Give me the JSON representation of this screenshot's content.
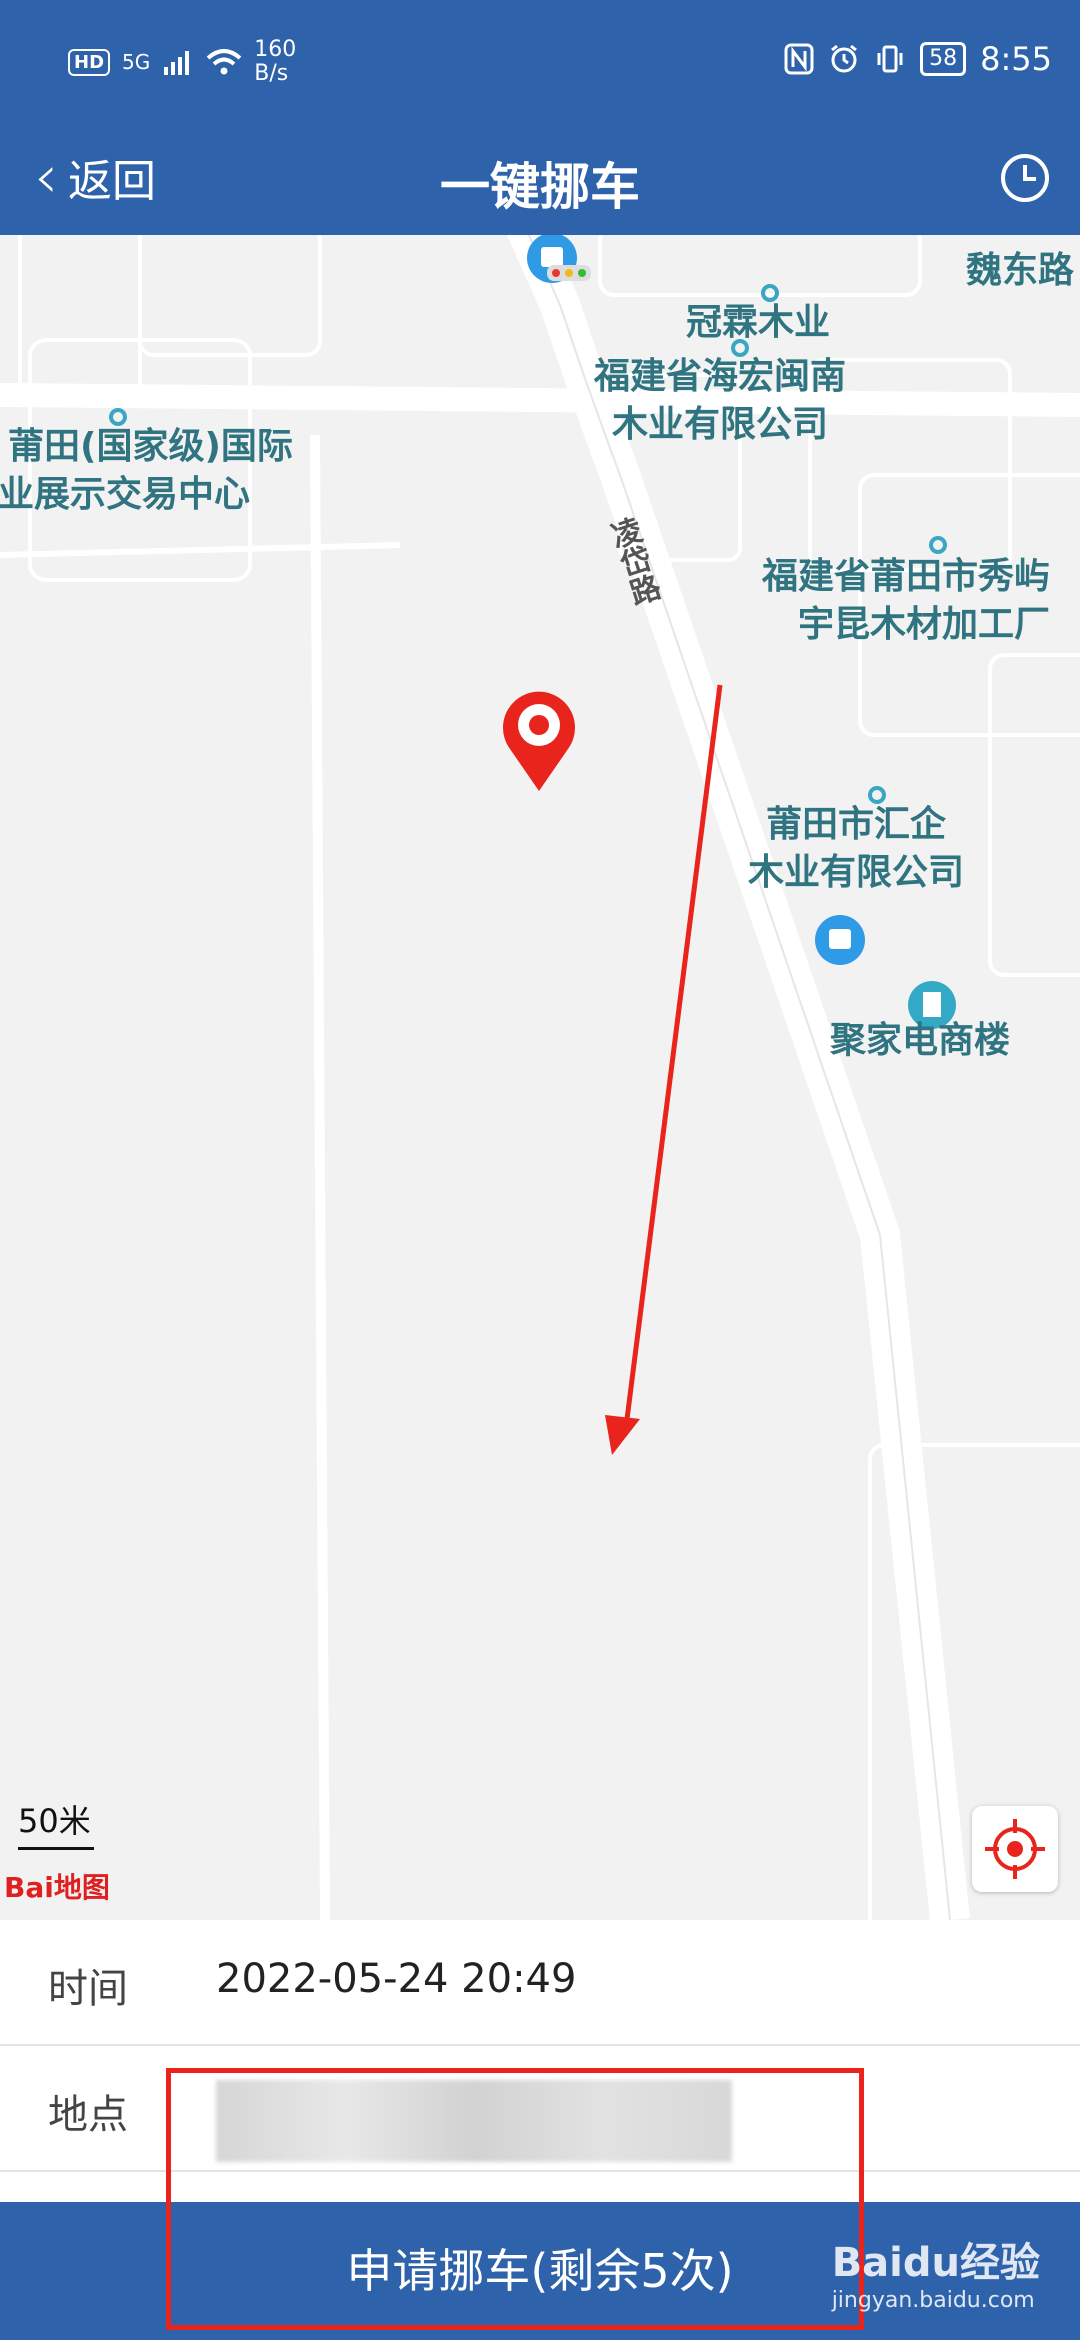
{
  "status_bar": {
    "hd": "HD",
    "network": "5G",
    "speed_value": "160",
    "speed_unit": "B/s",
    "battery": "58",
    "time": "8:55"
  },
  "header": {
    "back_label": "返回",
    "title": "一键挪车"
  },
  "map": {
    "labels": {
      "guanlin": "冠霖木业",
      "weidong": "魏东路",
      "haihong_1": "福建省海宏闽南",
      "haihong_2": "木业有限公司",
      "putian_expo_1": "莆田(国家级)国际",
      "putian_expo_2": "业展示交易中心",
      "lingdai_road": "凌岱路",
      "yukun_1": "福建省莆田市秀屿",
      "yukun_2": "宇昆木材加工厂",
      "huiqi_1": "莆田市汇企",
      "huiqi_2": "木业有限公司",
      "jujia": "聚家电商楼"
    },
    "scale": "50米",
    "logo": "Bai地图"
  },
  "form": {
    "time_label": "时间",
    "time_value": "2022-05-24 20:49",
    "location_label": "地点"
  },
  "submit_label": "申请挪车(剩余5次)",
  "watermark": {
    "brand": "Baidu经验",
    "url": "jingyan.baidu.com"
  },
  "colors": {
    "primary": "#2e62ab",
    "highlight_red": "#e8241c",
    "map_label": "#2f7480",
    "marker_red": "#e8241c"
  }
}
